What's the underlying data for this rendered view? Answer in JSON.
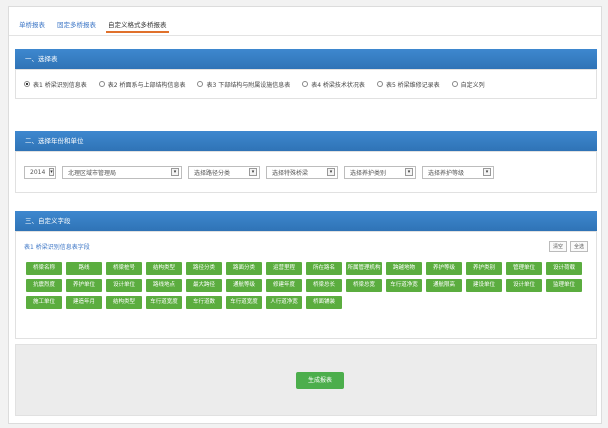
{
  "tabs": [
    "单桥报表",
    "固定多桥报表",
    "自定义格式多桥报表"
  ],
  "section1": {
    "title": "一、选择表",
    "radios": [
      {
        "label": "表1 桥梁识别信息表",
        "selected": true
      },
      {
        "label": "表2 桥面系与上部结构信息表",
        "selected": false
      },
      {
        "label": "表3 下部结构与附属设施信息表",
        "selected": false
      },
      {
        "label": "表4 桥梁技术状况表",
        "selected": false
      },
      {
        "label": "表5 桥梁维修记录表",
        "selected": false
      },
      {
        "label": "自定义列",
        "selected": false
      }
    ]
  },
  "section2": {
    "title": "二、选择年份和单位",
    "year": "2014",
    "unit": "北理区域市管理局",
    "route_class": "选择路径分类",
    "bridge_type": "选择特殊桥梁",
    "maintain_class": "选择养护类别",
    "maintain_level": "选择养护等级"
  },
  "section3": {
    "title": "三、自定义字段",
    "subtitle": "表1 桥梁识别信息表字段",
    "btn_clear": "清空",
    "btn_all": "全选",
    "fields": [
      "桥梁名称",
      "路线",
      "桥梁桩号",
      "结构类型",
      "路径分类",
      "路面分类",
      "运营里程",
      "所在路名",
      "所属管理机构",
      "跨越地物",
      "养护等级",
      "养护类别",
      "管理单位",
      "设计荷载",
      "抗震烈度",
      "养护单位",
      "设计单位",
      "路线地点",
      "最大跨径",
      "通航等级",
      "修建年度",
      "桥梁总长",
      "桥梁总宽",
      "车行道净宽",
      "通航限高",
      "建设单位",
      "设计单位",
      "监理单位",
      "施工单位",
      "建造年月",
      "结构类型",
      "车行道宽度",
      "车行道数",
      "车行道宽度",
      "人行道净宽",
      "桥面铺装"
    ]
  },
  "generate_btn": "生成报表"
}
